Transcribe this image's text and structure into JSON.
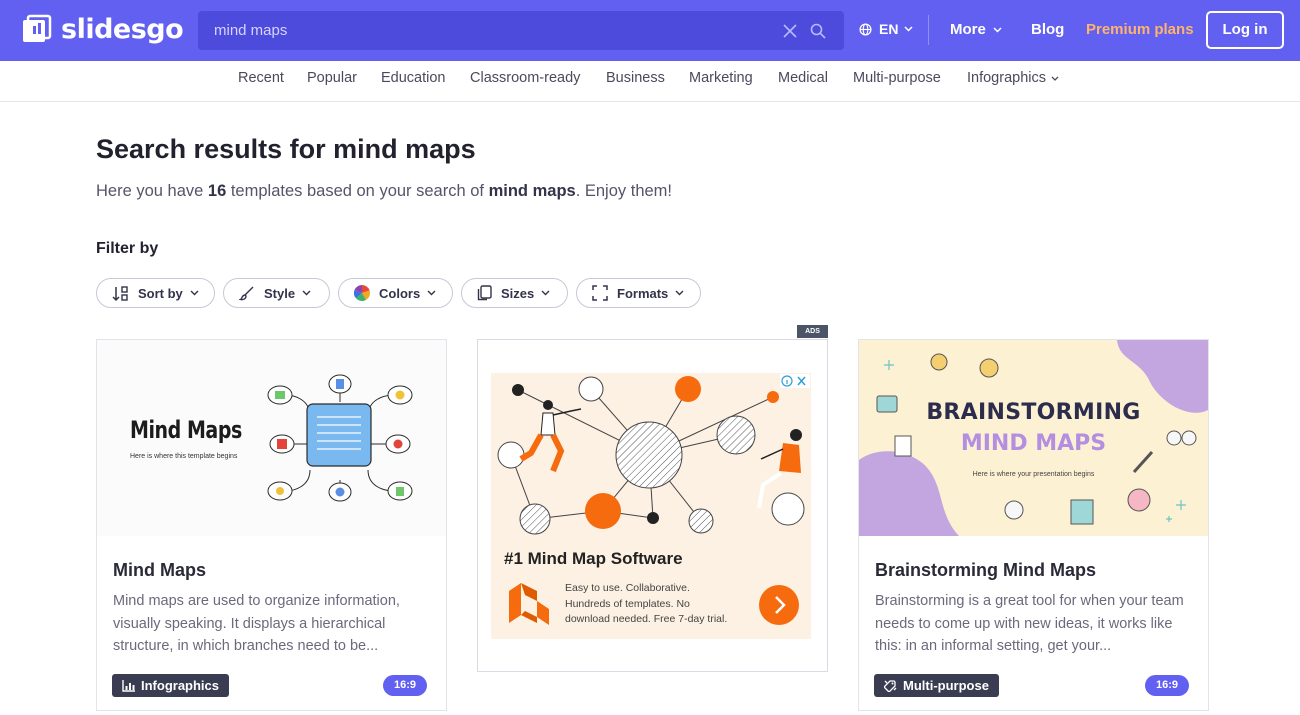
{
  "header": {
    "logo": "slidesgo",
    "search": {
      "value": "mind maps",
      "placeholder": "mind maps"
    },
    "language": "EN",
    "more": "More",
    "blog": "Blog",
    "premium": "Premium plans",
    "login": "Log in"
  },
  "categories": [
    "Recent",
    "Popular",
    "Education",
    "Classroom-ready",
    "Business",
    "Marketing",
    "Medical",
    "Multi-purpose",
    "Infographics"
  ],
  "main": {
    "title": "Search results for mind maps",
    "subtitle_pre": "Here you have ",
    "count": "16",
    "subtitle_mid": " templates based on your search of ",
    "query": "mind maps",
    "subtitle_post": ". Enjoy them!",
    "filter_label": "Filter by",
    "filters": [
      "Sort by",
      "Style",
      "Colors",
      "Sizes",
      "Formats"
    ]
  },
  "cards": [
    {
      "thumb_title": "Mind Maps",
      "thumb_subtitle": "Here is where this template begins",
      "title": "Mind Maps",
      "description": "Mind maps are used to organize information, visually speaking. It displays a hierarchical structure, in which branches need to be...",
      "tag": "Infographics",
      "ratio": "16:9"
    },
    {
      "thumb_title_1": "BRAINSTORMING",
      "thumb_title_2": "MIND MAPS",
      "thumb_subtitle": "Here is where your presentation begins",
      "title": "Brainstorming Mind Maps",
      "description": "Brainstorming is a great tool for when your team needs to come up with new ideas, it works like this: in an informal setting, get your...",
      "tag": "Multi-purpose",
      "ratio": "16:9"
    }
  ],
  "ad": {
    "label": "ADS",
    "title": "#1 Mind Map Software",
    "text": "Easy to use. Collaborative. Hundreds of templates. No download needed. Free 7-day trial."
  },
  "colors": {
    "brand": "#6160f0",
    "premium": "#ffb36b",
    "ad_accent": "#f66b0e",
    "tag_bg": "#3a3d52"
  }
}
